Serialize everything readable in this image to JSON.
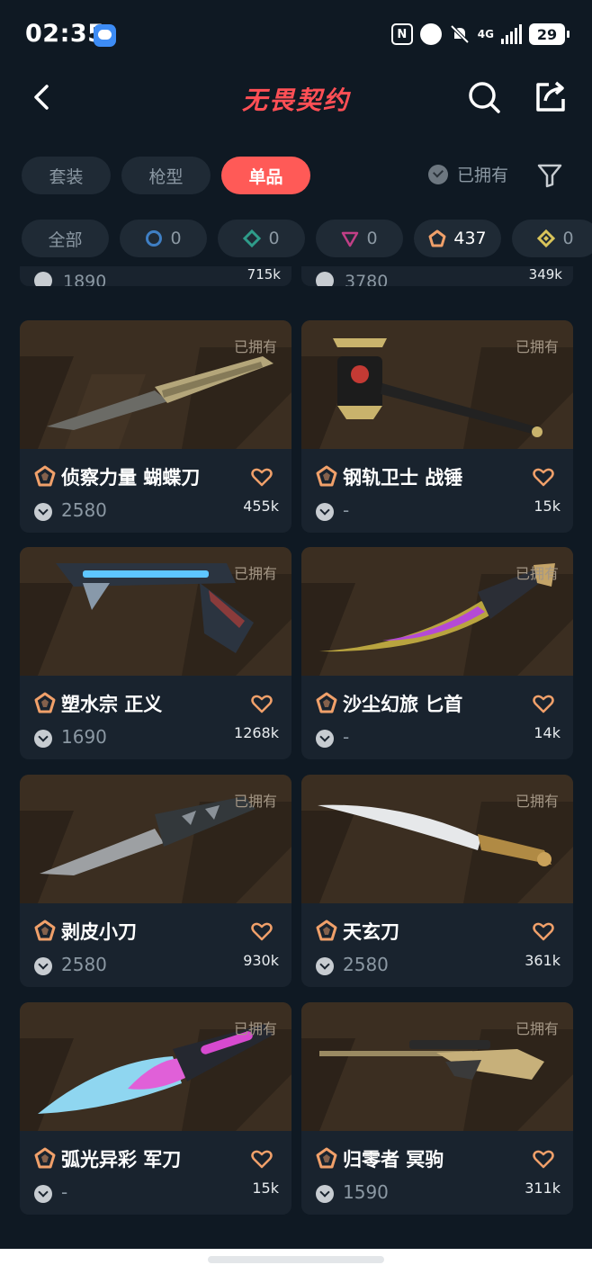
{
  "status_bar": {
    "time": "02:35",
    "network": "4G",
    "battery": "29"
  },
  "header": {
    "title": "无畏契约"
  },
  "tabs": [
    {
      "label": "套装",
      "active": false
    },
    {
      "label": "枪型",
      "active": false
    },
    {
      "label": "单品",
      "active": true
    }
  ],
  "owned_filter": {
    "label": "已拥有"
  },
  "tier_chips": [
    {
      "label": "全部",
      "tier": "all",
      "color": "#8b98a3"
    },
    {
      "label": "0",
      "tier": "select",
      "color": "#3f7fc4"
    },
    {
      "label": "0",
      "tier": "deluxe",
      "color": "#2f9c8a"
    },
    {
      "label": "0",
      "tier": "premium",
      "color": "#c13f86"
    },
    {
      "label": "437",
      "tier": "exclusive",
      "color": "#f0a06a"
    },
    {
      "label": "0",
      "tier": "ultra",
      "color": "#d9c45a"
    }
  ],
  "peek_row": [
    {
      "price": "1890",
      "views": "715k"
    },
    {
      "price": "3780",
      "views": "349k"
    }
  ],
  "items": [
    {
      "name": "侦察力量 蝴蝶刀",
      "price": "2580",
      "views": "455k",
      "owned": "已拥有"
    },
    {
      "name": "钢轨卫士 战锤",
      "price": "-",
      "views": "15k",
      "owned": "已拥有"
    },
    {
      "name": "塑水宗 正义",
      "price": "1690",
      "views": "1268k",
      "owned": "已拥有"
    },
    {
      "name": "沙尘幻旅 匕首",
      "price": "-",
      "views": "14k",
      "owned": "已拥有"
    },
    {
      "name": "剥皮小刀",
      "price": "2580",
      "views": "930k",
      "owned": "已拥有"
    },
    {
      "name": "天玄刀",
      "price": "2580",
      "views": "361k",
      "owned": "已拥有"
    },
    {
      "name": "弧光异彩 军刀",
      "price": "-",
      "views": "15k",
      "owned": "已拥有"
    },
    {
      "name": "归零者 冥驹",
      "price": "1590",
      "views": "311k",
      "owned": "已拥有"
    }
  ],
  "colors": {
    "background": "#0f1923",
    "card": "#19232e",
    "accent": "#ff5a57",
    "tier_exclusive": "#f0a06a",
    "favorite": "#f0a06a"
  }
}
